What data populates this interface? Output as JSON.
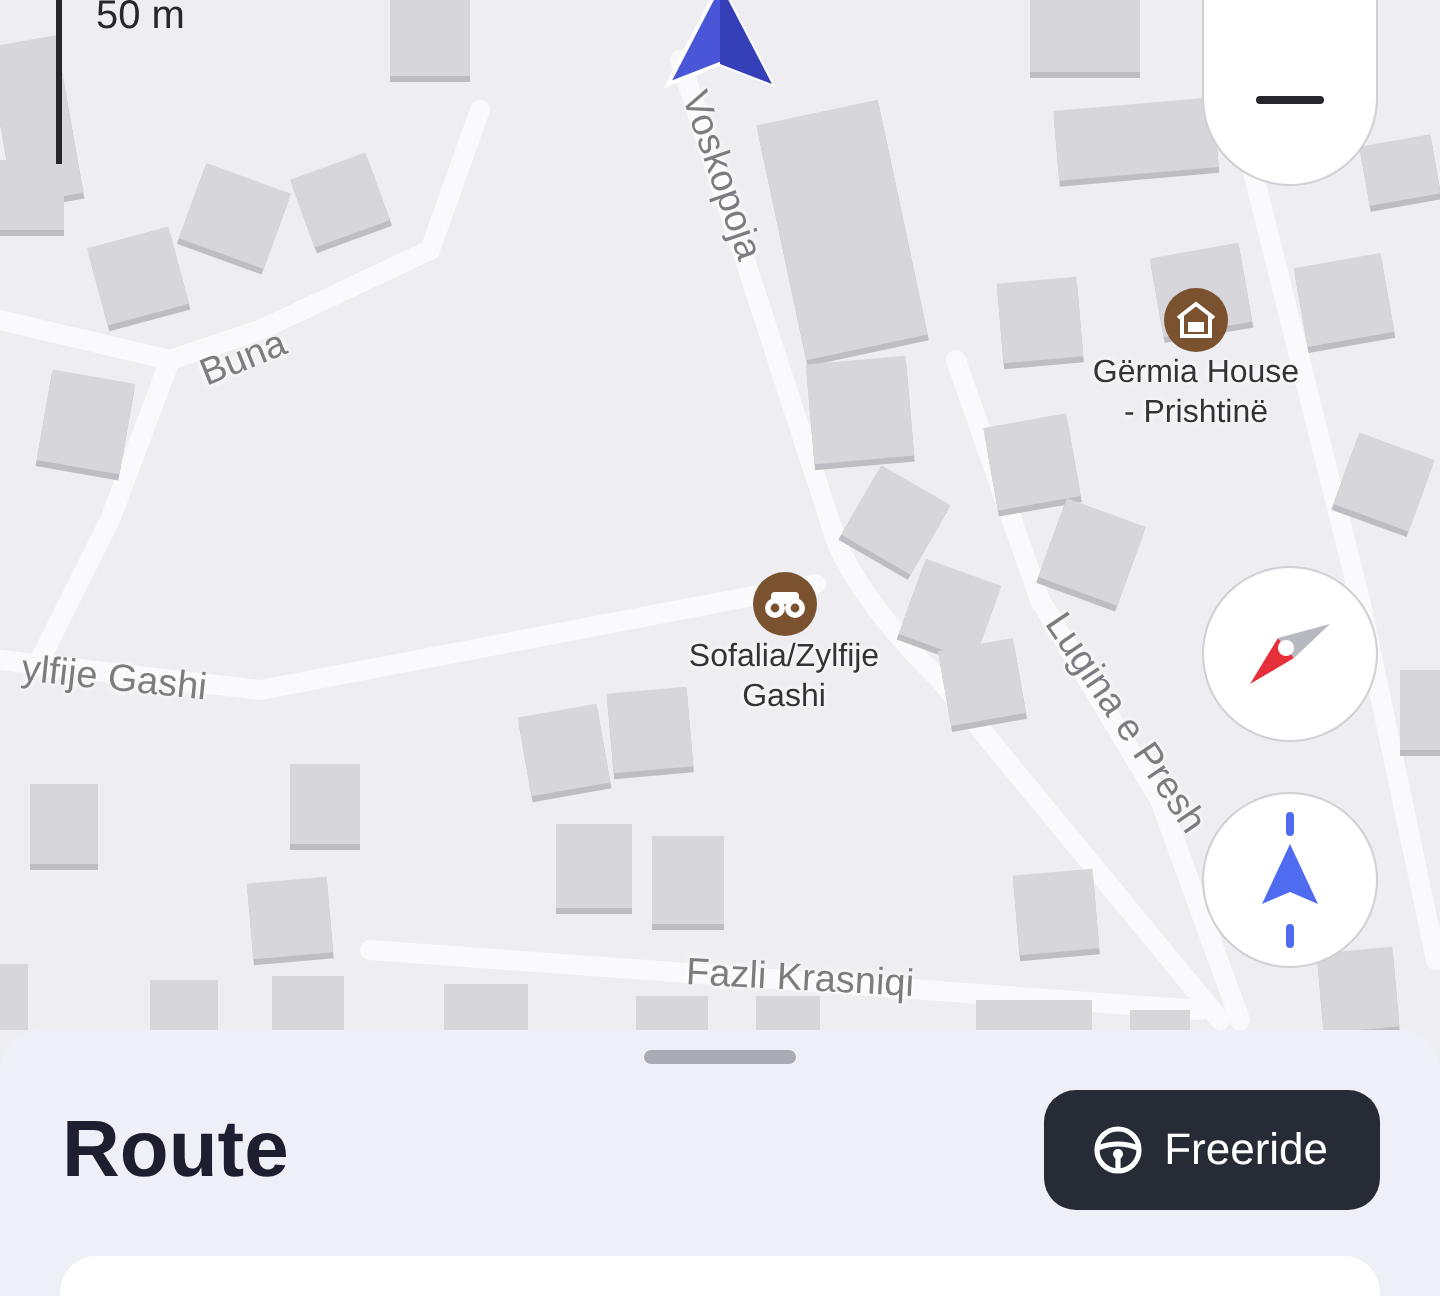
{
  "map": {
    "scale_label": "50 m",
    "street_labels": [
      {
        "text": "Voskopoja"
      },
      {
        "text": "Buna"
      },
      {
        "text": "ylfije Gashi"
      },
      {
        "text": "Lugina e Presh"
      },
      {
        "text": "Fazli Krasniqi"
      }
    ],
    "pois": [
      {
        "name": "Gërmia House - Prishtinë",
        "kind": "lodging"
      },
      {
        "name": "Sofalia/Zylfije Gashi",
        "kind": "viewpoint"
      }
    ],
    "controls": [
      {
        "kind": "zoom-out"
      },
      {
        "kind": "compass"
      },
      {
        "kind": "recenter"
      }
    ]
  },
  "sheet": {
    "title": "Route",
    "mode_button": "Freeride"
  }
}
